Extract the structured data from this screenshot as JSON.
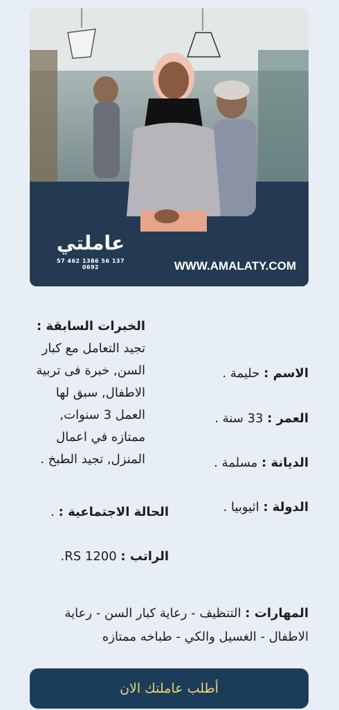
{
  "photo": {
    "logo_text": "عاملتي",
    "logo_phones": "57 462 1386  56 137 0692",
    "website": "WWW.AMALATY.COM"
  },
  "experience": {
    "title": "الخبرات السابقة :",
    "body": "تجيد التعامل مع كبار السن, خبرة فى تربية الاطفال, سبق لها العمل 3 سنوات, ممتازه في اعمال المنزل, تجيد الطبخ ."
  },
  "fields": {
    "name_label": "الاسم :",
    "name_value": "حليمة .",
    "age_label": "العمر :",
    "age_value": "33 سنة .",
    "religion_label": "الديانة :",
    "religion_value": "مسلمة .",
    "country_label": "الدولة :",
    "country_value": "اثيوبيا .",
    "marital_label": "الحالة الاجتماعية :",
    "marital_value": ".",
    "salary_label": "الراتب :",
    "salary_value": "RS 1200."
  },
  "skills": {
    "label": "المهارات :",
    "value": "التنظيف - رعاية كبار السن - رعاية الاطفال - الغسيل والكي - طباخه ممتازه"
  },
  "cta": {
    "label": "أطلب عاملتك الان"
  },
  "colors": {
    "button_bg": "#1c3d59",
    "button_text": "#e8d37a",
    "page_bg": "#e8eef5"
  }
}
